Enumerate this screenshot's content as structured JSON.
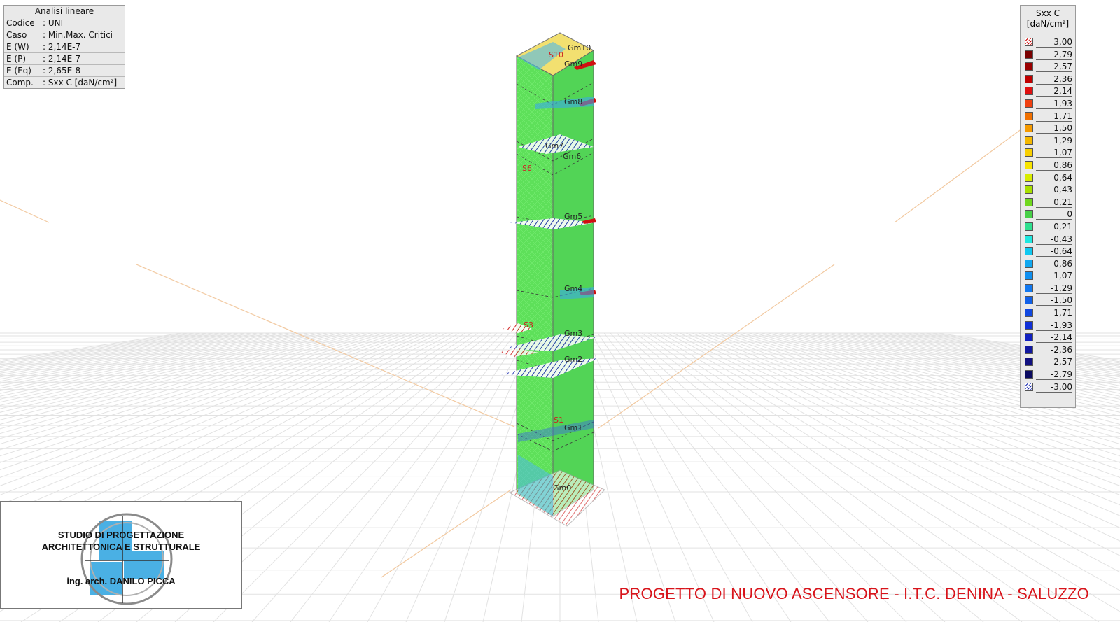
{
  "info_panel": {
    "title": "Analisi lineare",
    "rows": [
      {
        "key": "Codice",
        "value": ": UNI"
      },
      {
        "key": "Caso",
        "value": ": Min,Max. Critici"
      },
      {
        "key": "E (W)",
        "value": ": 2,14E-7"
      },
      {
        "key": "E (P)",
        "value": ": 2,14E-7"
      },
      {
        "key": "E (Eq)",
        "value": ": 2,65E-8"
      },
      {
        "key": "Comp.",
        "value": ": Sxx C [daN/cm²]"
      }
    ]
  },
  "legend": {
    "title": "Sxx C",
    "unit": "[daN/cm²]",
    "entries": [
      {
        "value": "3,00",
        "color": "hatch-red"
      },
      {
        "value": "2,79",
        "color": "#7a0000"
      },
      {
        "value": "2,57",
        "color": "#9a0000"
      },
      {
        "value": "2,36",
        "color": "#c00000"
      },
      {
        "value": "2,14",
        "color": "#e01010"
      },
      {
        "value": "1,93",
        "color": "#f04010"
      },
      {
        "value": "1,71",
        "color": "#f07000"
      },
      {
        "value": "1,50",
        "color": "#f59a00"
      },
      {
        "value": "1,29",
        "color": "#f5b800"
      },
      {
        "value": "1,07",
        "color": "#f8cf00"
      },
      {
        "value": "0,86",
        "color": "#f8e400"
      },
      {
        "value": "0,64",
        "color": "#d8ec00"
      },
      {
        "value": "0,43",
        "color": "#a8e000"
      },
      {
        "value": "0,21",
        "color": "#70d820"
      },
      {
        "value": "0",
        "color": "#48d048"
      },
      {
        "value": "-0,21",
        "color": "#30e090"
      },
      {
        "value": "-0,43",
        "color": "#20e8e0"
      },
      {
        "value": "-0,64",
        "color": "#10c8f0"
      },
      {
        "value": "-0,86",
        "color": "#10a8f0"
      },
      {
        "value": "-1,07",
        "color": "#1090f0"
      },
      {
        "value": "-1,29",
        "color": "#1078f0"
      },
      {
        "value": "-1,50",
        "color": "#1060e8"
      },
      {
        "value": "-1,71",
        "color": "#1048e0"
      },
      {
        "value": "-1,93",
        "color": "#1030d8"
      },
      {
        "value": "-2,14",
        "color": "#1020c0"
      },
      {
        "value": "-2,36",
        "color": "#1018a0"
      },
      {
        "value": "-2,57",
        "color": "#101080"
      },
      {
        "value": "-2,79",
        "color": "#0a0a60"
      },
      {
        "value": "-3,00",
        "color": "hatch-blue"
      }
    ]
  },
  "model_labels": {
    "gm": [
      "Gm0",
      "Gm1",
      "Gm2",
      "Gm3",
      "Gm4",
      "Gm5",
      "Gm6",
      "Gm7",
      "Gm8",
      "Gm9",
      "Gm10"
    ],
    "s": [
      "S1",
      "S3",
      "S6",
      "S10"
    ]
  },
  "logo": {
    "line1": "STUDIO DI PROGETTAZIONE",
    "line2": "ARCHITETTONICA E STRUTTURALE",
    "line3": "ing. arch. DANILO PICCA",
    "accent_color": "#4ab0e4"
  },
  "footer": {
    "title": "PROGETTO DI NUOVO ASCENSORE - I.T.C. DENINA - SALUZZO",
    "color": "#d8141b"
  }
}
